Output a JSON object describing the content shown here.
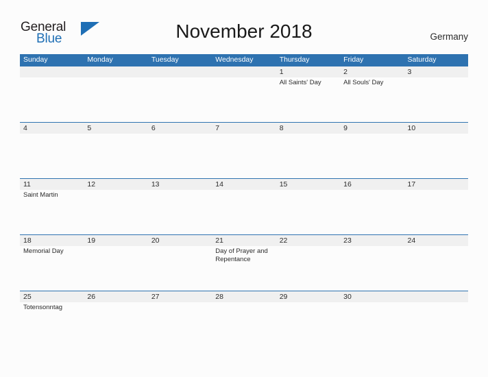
{
  "brand": {
    "name_part1": "General",
    "name_part2": "Blue",
    "flag_icon": "blue-triangle-flag-icon",
    "color_primary": "#1f6fb5",
    "color_text": "#231f20"
  },
  "header": {
    "title": "November 2018",
    "country": "Germany"
  },
  "calendar": {
    "month": "November",
    "year": "2018",
    "header_bg": "#2e72b0",
    "row_band_bg": "#f0f0f0",
    "grid_line": "#2e72b0",
    "day_headers": [
      "Sunday",
      "Monday",
      "Tuesday",
      "Wednesday",
      "Thursday",
      "Friday",
      "Saturday"
    ],
    "weeks": [
      {
        "days": [
          {
            "num": "",
            "holiday": ""
          },
          {
            "num": "",
            "holiday": ""
          },
          {
            "num": "",
            "holiday": ""
          },
          {
            "num": "",
            "holiday": ""
          },
          {
            "num": "1",
            "holiday": "All Saints' Day"
          },
          {
            "num": "2",
            "holiday": "All Souls' Day"
          },
          {
            "num": "3",
            "holiday": ""
          }
        ]
      },
      {
        "days": [
          {
            "num": "4",
            "holiday": ""
          },
          {
            "num": "5",
            "holiday": ""
          },
          {
            "num": "6",
            "holiday": ""
          },
          {
            "num": "7",
            "holiday": ""
          },
          {
            "num": "8",
            "holiday": ""
          },
          {
            "num": "9",
            "holiday": ""
          },
          {
            "num": "10",
            "holiday": ""
          }
        ]
      },
      {
        "days": [
          {
            "num": "11",
            "holiday": "Saint Martin"
          },
          {
            "num": "12",
            "holiday": ""
          },
          {
            "num": "13",
            "holiday": ""
          },
          {
            "num": "14",
            "holiday": ""
          },
          {
            "num": "15",
            "holiday": ""
          },
          {
            "num": "16",
            "holiday": ""
          },
          {
            "num": "17",
            "holiday": ""
          }
        ]
      },
      {
        "days": [
          {
            "num": "18",
            "holiday": "Memorial Day"
          },
          {
            "num": "19",
            "holiday": ""
          },
          {
            "num": "20",
            "holiday": ""
          },
          {
            "num": "21",
            "holiday": "Day of Prayer and Repentance"
          },
          {
            "num": "22",
            "holiday": ""
          },
          {
            "num": "23",
            "holiday": ""
          },
          {
            "num": "24",
            "holiday": ""
          }
        ]
      },
      {
        "days": [
          {
            "num": "25",
            "holiday": "Totensonntag"
          },
          {
            "num": "26",
            "holiday": ""
          },
          {
            "num": "27",
            "holiday": ""
          },
          {
            "num": "28",
            "holiday": ""
          },
          {
            "num": "29",
            "holiday": ""
          },
          {
            "num": "30",
            "holiday": ""
          },
          {
            "num": "",
            "holiday": ""
          }
        ]
      }
    ]
  }
}
